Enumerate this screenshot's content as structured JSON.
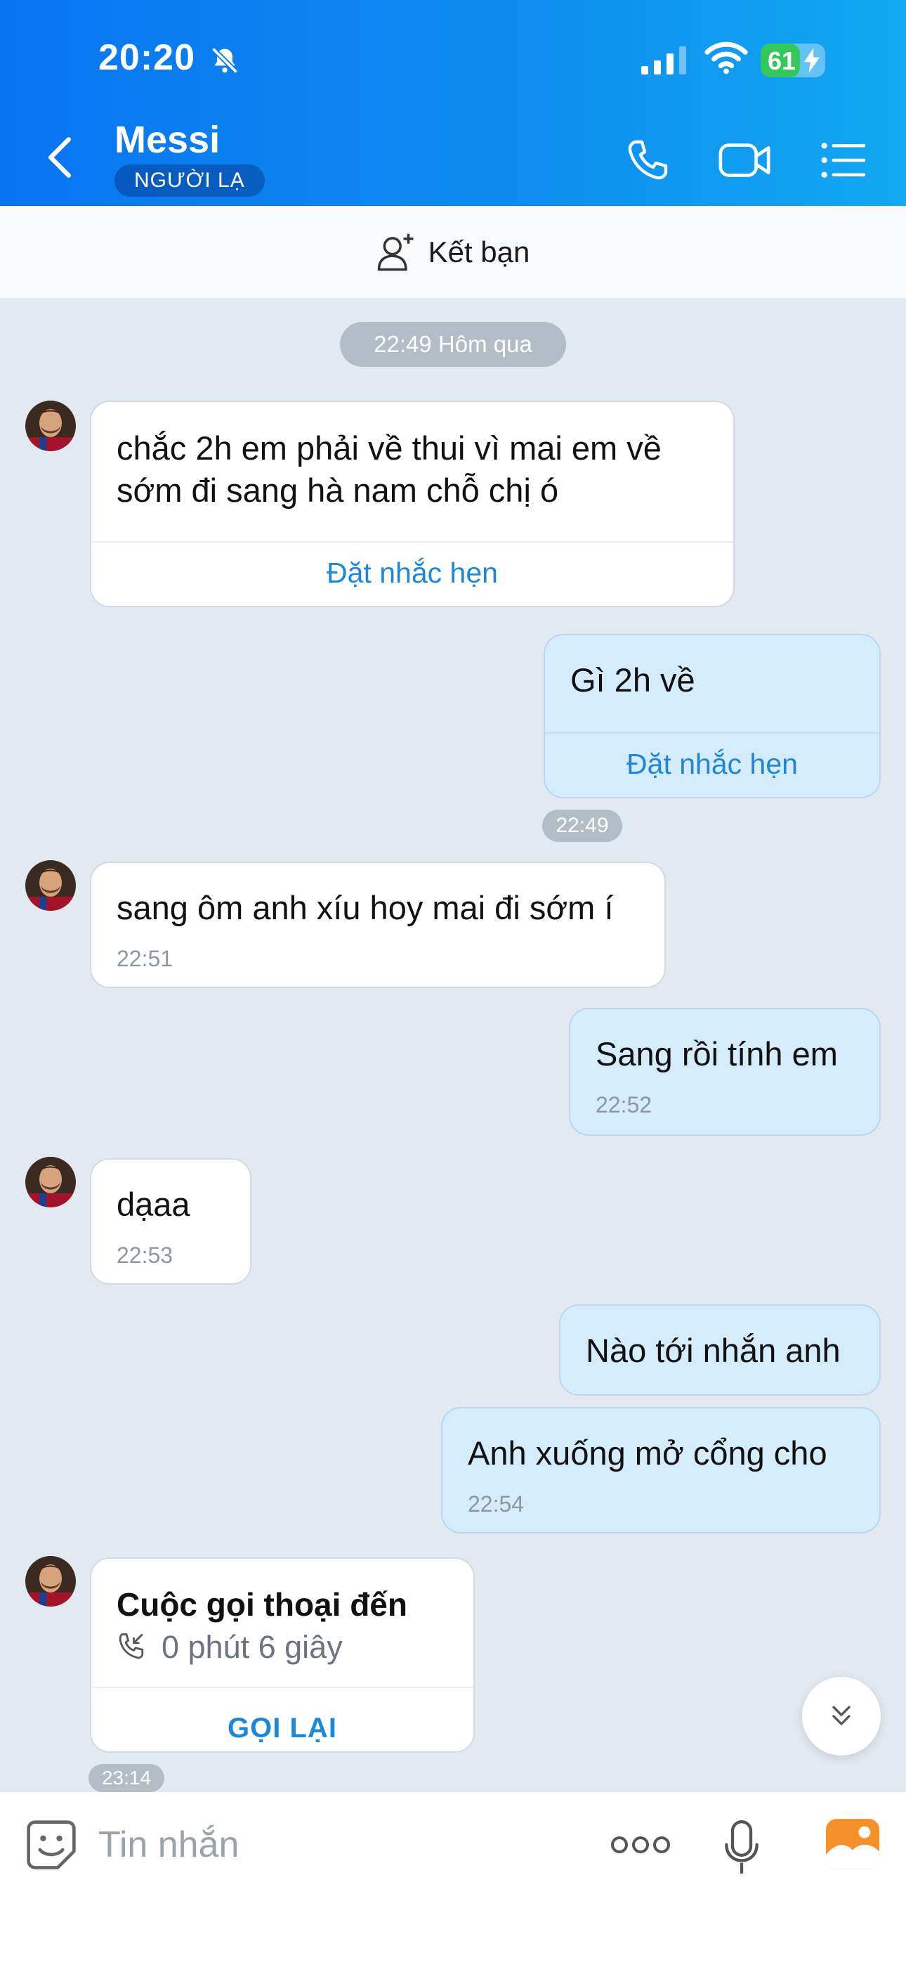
{
  "status_bar": {
    "time": "20:20",
    "battery": "61",
    "battery_level": 0.61
  },
  "header": {
    "contact_name": "Messi",
    "badge": "NGƯỜI LẠ"
  },
  "friend_bar": {
    "label": "Kết bạn"
  },
  "date_separator": "22:49 Hôm qua",
  "messages": [
    {
      "side": "in",
      "lines": [
        "chắc 2h em phải về thui vì mai em về",
        "sớm đi sang hà nam chỗ chị ó"
      ],
      "action": "Đặt nhắc hẹn"
    },
    {
      "side": "out",
      "text": "Gì 2h về",
      "action": "Đặt nhắc hẹn",
      "time": "22:49"
    },
    {
      "side": "in",
      "text": "sang ôm anh xíu hoy mai đi sớm í",
      "time": "22:51"
    },
    {
      "side": "out",
      "text": "Sang rồi tính em",
      "time": "22:52"
    },
    {
      "side": "in",
      "text": "dạaa",
      "time": "22:53"
    },
    {
      "side": "out",
      "text": "Nào tới nhắn anh"
    },
    {
      "side": "out",
      "text": "Anh xuống mở cổng cho",
      "time": "22:54"
    },
    {
      "side": "in",
      "type": "call",
      "title": "Cuộc gọi thoại đến",
      "duration": "0 phút 6 giây",
      "action": "GỌI LẠI",
      "time": "23:14"
    }
  ],
  "input": {
    "placeholder": "Tin nhắn"
  },
  "icons": {
    "bell": "bell-slash-icon",
    "signal": "signal-icon",
    "wifi": "wifi-icon",
    "back": "chevron-left-icon",
    "call": "phone-icon",
    "video": "video-camera-icon",
    "menu": "list-menu-icon",
    "add_friend": "user-plus-icon",
    "emoji": "sticker-icon",
    "more": "more-dots-icon",
    "mic": "microphone-icon",
    "gallery": "image-icon",
    "scroll": "double-chevron-down-icon",
    "incoming_call": "incoming-call-icon"
  },
  "colors": {
    "header": "#0a74f0",
    "accent": "#1f87d8",
    "chat_bg": "#e2e9f1",
    "out_bubble": "#d5ecfc",
    "battery": "#34c759"
  }
}
